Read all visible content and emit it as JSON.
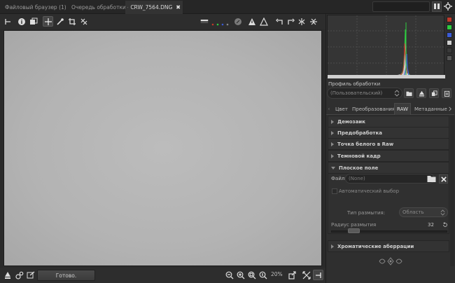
{
  "tabs": [
    {
      "label": "Файловый браузер (1)",
      "icon": "image-icon"
    },
    {
      "label": "Очередь обработки",
      "icon": "gears-icon"
    },
    {
      "label": "CRW_7564.DNG",
      "icon": "image-icon",
      "close": "✖"
    }
  ],
  "status": {
    "text": "Готово.",
    "zoom": "20%"
  },
  "profile": {
    "label": "Профиль обработки",
    "value": "(Пользовательский)"
  },
  "panel_tabs": [
    "Цвет",
    "Преобразования",
    "RAW",
    "Метаданные"
  ],
  "active_panel_tab": "RAW",
  "sections": {
    "demosaic": "Демозаик",
    "preprocess": "Предобработка",
    "whitepoint": "Точка белого в Raw",
    "darkframe": "Темновой кадр",
    "flatfield": "Плоское поле",
    "ca": "Хроматические аберрации"
  },
  "flatfield": {
    "file_label": "Файл",
    "file_value": "(None)",
    "auto_label": "Автоматический выбор",
    "blur_type_label": "Тип размытия:",
    "blur_type_value": "Область",
    "radius_label": "Радиус размытия",
    "radius_value": "32",
    "radius_min": 0,
    "radius_max": 200
  },
  "colors": {
    "accent": "#4a4a4a",
    "histo_red": "#c0392b",
    "histo_green": "#2ecc40",
    "histo_blue": "#3b5bd6"
  }
}
